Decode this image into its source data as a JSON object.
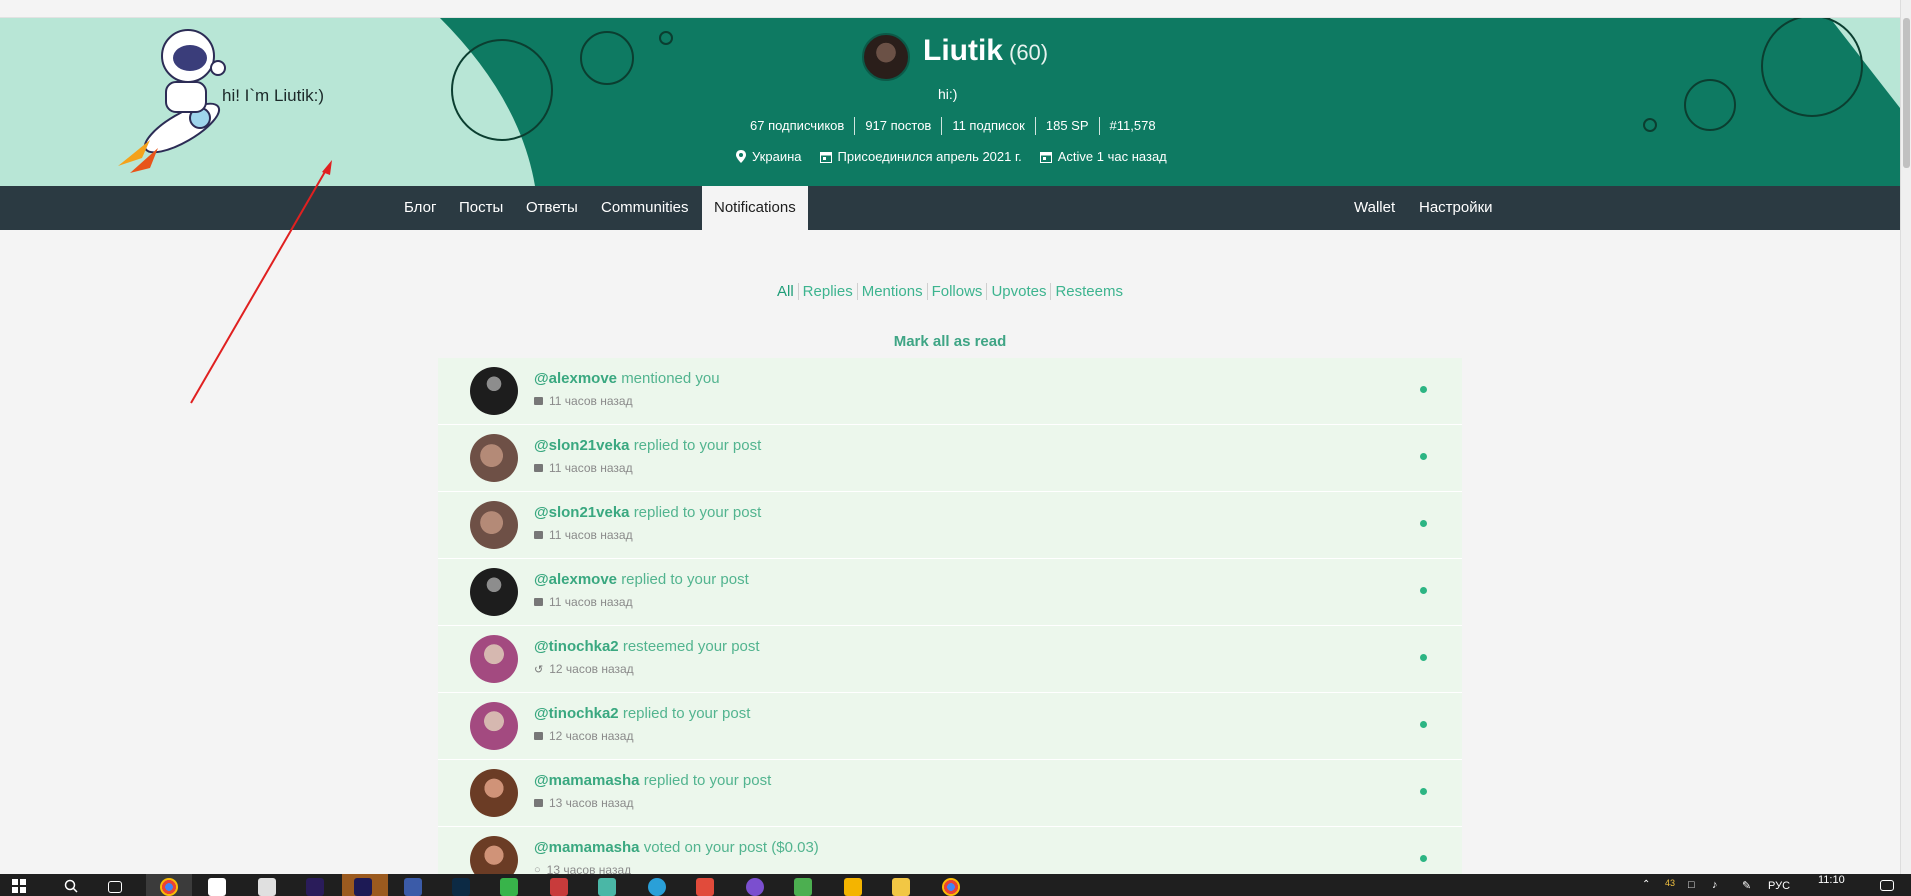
{
  "cover": {
    "greeting": "hi! I`m Liutik:)"
  },
  "profile": {
    "name": "Liutik",
    "reputation": "(60)",
    "about": "hi:)",
    "stats": [
      "67 подписчиков",
      "917 постов",
      "11 подписок",
      "185 SP",
      "#11,578"
    ],
    "location": "Украина",
    "joined": "Присоединился апрель 2021 г.",
    "active": "Active 1 час назад"
  },
  "nav": {
    "left": [
      "Блог",
      "Посты",
      "Ответы",
      "Communities",
      "Notifications"
    ],
    "right": [
      "Wallet",
      "Настройки"
    ],
    "active": "Notifications"
  },
  "filters": [
    "All",
    "Replies",
    "Mentions",
    "Follows",
    "Upvotes",
    "Resteems"
  ],
  "mark_all_read": "Mark all as read",
  "notifications": [
    {
      "user": "@alexmove",
      "action": "mentioned you",
      "time": "11 часов назад",
      "icon": "mention-icon"
    },
    {
      "user": "@slon21veka",
      "action": "replied to your post",
      "time": "11 часов назад",
      "icon": "comment-icon"
    },
    {
      "user": "@slon21veka",
      "action": "replied to your post",
      "time": "11 часов назад",
      "icon": "comment-icon"
    },
    {
      "user": "@alexmove",
      "action": "replied to your post",
      "time": "11 часов назад",
      "icon": "comment-icon"
    },
    {
      "user": "@tinochka2",
      "action": "resteemed your post",
      "time": "12 часов назад",
      "icon": "resteem-icon"
    },
    {
      "user": "@tinochka2",
      "action": "replied to your post",
      "time": "12 часов назад",
      "icon": "comment-icon"
    },
    {
      "user": "@mamamasha",
      "action": "replied to your post",
      "time": "13 часов назад",
      "icon": "comment-icon"
    },
    {
      "user": "@mamamasha",
      "action": "voted on your post ($0.03)",
      "time": "13 часов назад",
      "icon": "upvote-icon"
    }
  ],
  "taskbar": {
    "lang": "РУС",
    "time": "11:10",
    "tray_count": "43"
  },
  "colors": {
    "cover_green": "#0e7a62",
    "cover_light": "#b8e6d6",
    "nav_dark": "#2b3a42",
    "accent": "#3aa880",
    "notif_bg": "#ecf7ec",
    "arrow_red": "#e02020"
  }
}
